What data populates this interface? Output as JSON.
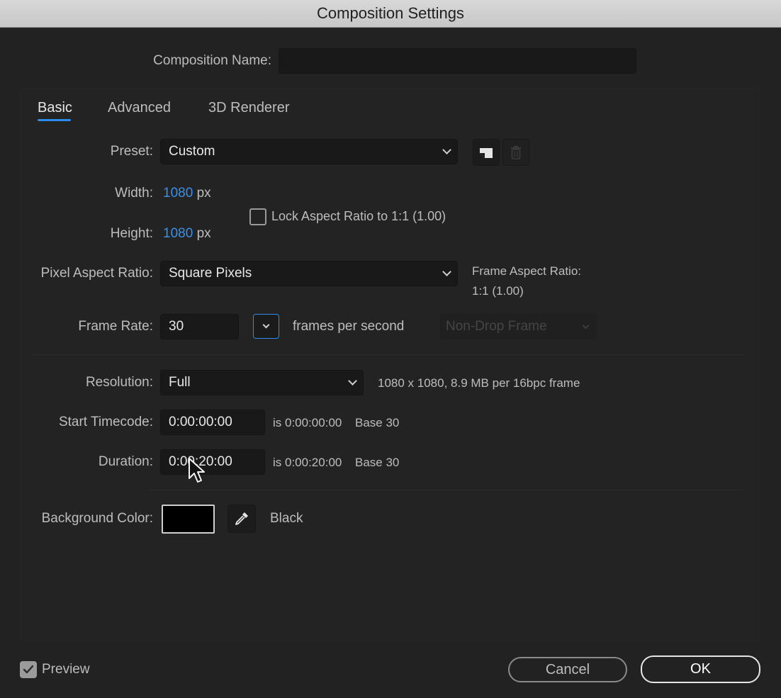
{
  "window": {
    "title": "Composition Settings"
  },
  "composition_name": {
    "label": "Composition Name:",
    "value": ""
  },
  "tabs": [
    {
      "label": "Basic",
      "active": true
    },
    {
      "label": "Advanced",
      "active": false
    },
    {
      "label": "3D Renderer",
      "active": false
    }
  ],
  "preset": {
    "label": "Preset:",
    "value": "Custom"
  },
  "width": {
    "label": "Width:",
    "value": "1080",
    "unit": "px"
  },
  "height": {
    "label": "Height:",
    "value": "1080",
    "unit": "px"
  },
  "lock_aspect": {
    "label": "Lock Aspect Ratio to 1:1 (1.00)",
    "checked": false
  },
  "pixel_aspect": {
    "label": "Pixel Aspect Ratio:",
    "value": "Square Pixels"
  },
  "frame_aspect": {
    "label": "Frame Aspect Ratio:",
    "value": "1:1 (1.00)"
  },
  "frame_rate": {
    "label": "Frame Rate:",
    "value": "30",
    "unit": "frames per second",
    "drop_frame": "Non-Drop Frame"
  },
  "resolution": {
    "label": "Resolution:",
    "value": "Full",
    "info": "1080 x 1080, 8.9 MB per 16bpc frame"
  },
  "start_timecode": {
    "label": "Start Timecode:",
    "value": "0:00:00:00",
    "is_text": "is 0:00:00:00",
    "base": "Base 30"
  },
  "duration": {
    "label": "Duration:",
    "value": "0:00:20:00",
    "is_text": "is 0:00:20:00",
    "base": "Base 30"
  },
  "background_color": {
    "label": "Background Color:",
    "name": "Black",
    "swatch": "#000000"
  },
  "preview": {
    "label": "Preview",
    "checked": true
  },
  "buttons": {
    "cancel": "Cancel",
    "ok": "OK"
  },
  "colors": {
    "accent": "#2d8ceb",
    "value_blue": "#3b8fe6",
    "background": "#222222"
  },
  "icons": [
    "new-preset-icon",
    "trash-icon",
    "chevron-down-icon",
    "eyedropper-icon",
    "checkbox-icon",
    "cursor-icon"
  ]
}
